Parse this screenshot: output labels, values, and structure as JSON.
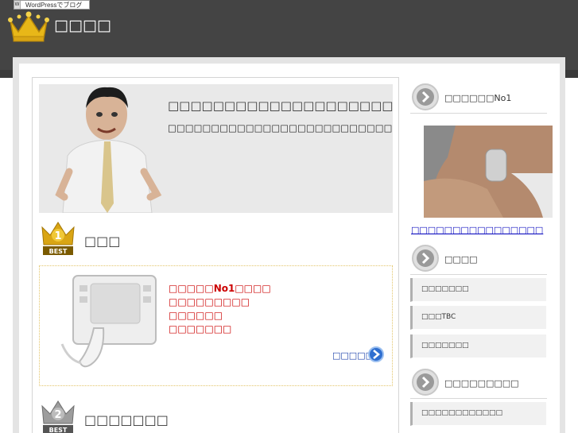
{
  "header": {
    "wp_badge": "WordPressでブログ",
    "site_title": "□□□□"
  },
  "hero": {
    "title": "□□□□□□□□□□□□□□□□□□□□□",
    "body": "□□□□□□□□□□□□□□□□□□□□□□□□□□□□□□□□□□□□□□□□□□□"
  },
  "rank1": {
    "label": "1",
    "best": "BEST",
    "title": "□□□",
    "lines": [
      "□□□□□No1□□□□",
      "□□□□□□□□□",
      "□□□□□□",
      "□□□□□□□"
    ],
    "detail": "□□□□□□"
  },
  "rank2": {
    "label": "2",
    "best": "BEST",
    "title": "□□□□□□□"
  },
  "sidebar": {
    "section1_title": "□□□□□□No1",
    "image_link": "□□□□□□□□□□□□□□□□",
    "section2_title": "□□□□",
    "items2": [
      "□□□□□□□",
      "□□□TBC",
      "□□□□□□□"
    ],
    "section3_title": "□□□□□□□□□",
    "items3": [
      "□□□□□□□□□□□□"
    ]
  }
}
